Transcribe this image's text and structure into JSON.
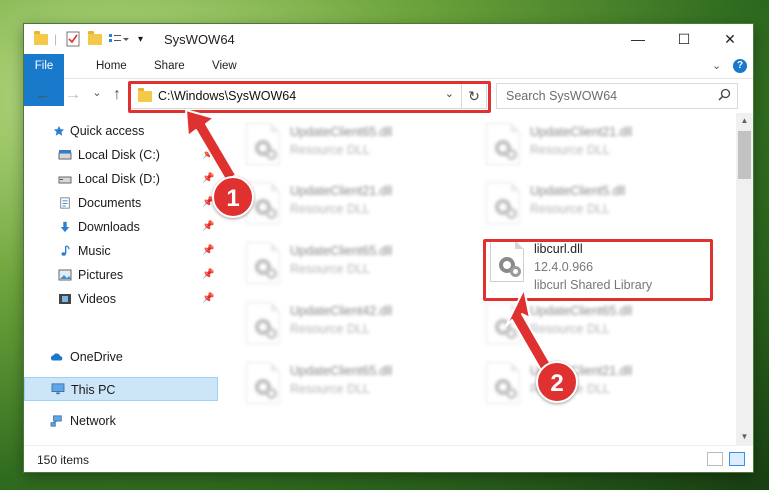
{
  "window": {
    "title": "SysWOW64",
    "minimize_glyph": "—",
    "maximize_glyph": "☐",
    "close_glyph": "✕"
  },
  "ribbon": {
    "tabs": [
      "File",
      "Home",
      "Share",
      "View"
    ],
    "expand_glyph": "⌄",
    "help_glyph": "?"
  },
  "nav": {
    "back_glyph": "←",
    "forward_glyph": "→",
    "recent_glyph": "⌄",
    "up_glyph": "↑"
  },
  "address": {
    "path": "C:\\Windows\\SysWOW64",
    "dropdown_glyph": "⌄",
    "refresh_glyph": "↻"
  },
  "search": {
    "placeholder": "Search SysWOW64",
    "icon": "magnifier-icon"
  },
  "sidebar": {
    "items": [
      {
        "label": "Quick access",
        "icon": "star-icon",
        "pinned": false
      },
      {
        "label": "Local Disk (C:)",
        "icon": "drive-icon",
        "pinned": true
      },
      {
        "label": "Local Disk (D:)",
        "icon": "drive-icon",
        "pinned": true
      },
      {
        "label": "Documents",
        "icon": "documents-icon",
        "pinned": true
      },
      {
        "label": "Downloads",
        "icon": "download-arrow-icon",
        "pinned": true
      },
      {
        "label": "Music",
        "icon": "music-note-icon",
        "pinned": true
      },
      {
        "label": "Pictures",
        "icon": "pictures-icon",
        "pinned": true
      },
      {
        "label": "Videos",
        "icon": "film-icon",
        "pinned": true
      },
      {
        "label": "OneDrive",
        "icon": "cloud-icon",
        "pinned": false
      },
      {
        "label": "This PC",
        "icon": "monitor-icon",
        "pinned": false,
        "selected": true
      },
      {
        "label": "Network",
        "icon": "network-icon",
        "pinned": false
      }
    ],
    "pin_glyph": "📌"
  },
  "files": [
    {
      "name": "UpdateClient65.dll",
      "desc": "Resource DLL",
      "blurred": true
    },
    {
      "name": "UpdateClient21.dll",
      "desc": "Resource DLL",
      "blurred": true
    },
    {
      "name": "UpdateClient21.dll",
      "desc": "Resource DLL",
      "blurred": true
    },
    {
      "name": "UpdateClient5.dll",
      "desc": "Resource DLL",
      "blurred": true
    },
    {
      "name": "UpdateClient65.dll",
      "desc": "Resource DLL",
      "blurred": true
    },
    {
      "name": "libcurl.dll",
      "version": "12.4.0.966",
      "desc": "libcurl Shared Library",
      "blurred": false,
      "highlighted": true
    },
    {
      "name": "UpdateClient42.dll",
      "desc": "Resource DLL",
      "blurred": true
    },
    {
      "name": "UpdateClient65.dll",
      "desc": "Resource DLL",
      "blurred": true
    },
    {
      "name": "UpdateClient65.dll",
      "desc": "Resource DLL",
      "blurred": true
    },
    {
      "name": "UpdateClient21.dll",
      "desc": "Resource DLL",
      "blurred": true
    }
  ],
  "status": {
    "item_count": "150 items"
  },
  "annotations": {
    "step1": "1",
    "step2": "2",
    "color": "#e03131"
  },
  "colors": {
    "accent": "#1979ca",
    "selection": "#cde6f7",
    "annotation_red": "#e03131"
  }
}
